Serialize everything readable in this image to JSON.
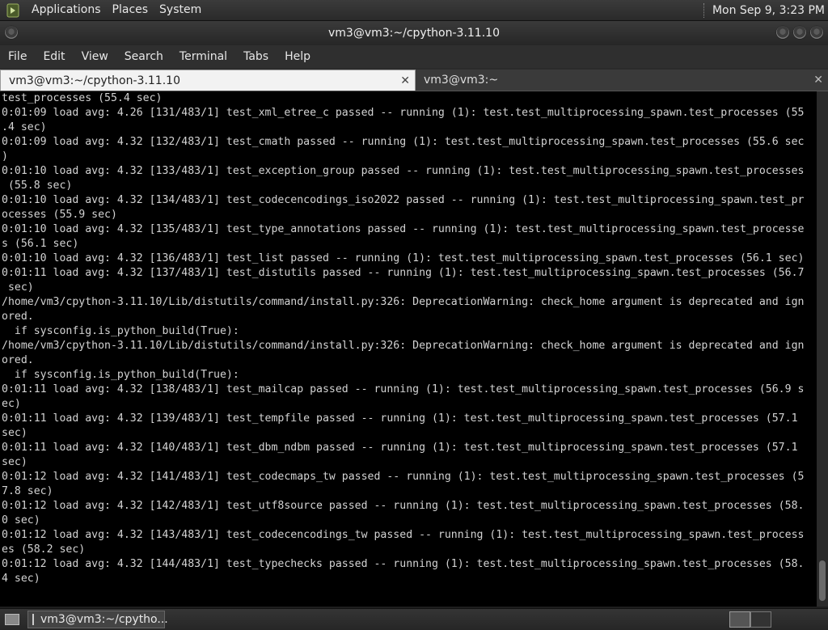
{
  "top_panel": {
    "menus": [
      "Applications",
      "Places",
      "System"
    ],
    "clock": "Mon Sep  9,  3:23 PM"
  },
  "window": {
    "title": "vm3@vm3:~/cpython-3.11.10"
  },
  "menubar": [
    "File",
    "Edit",
    "View",
    "Search",
    "Terminal",
    "Tabs",
    "Help"
  ],
  "tabs": [
    {
      "label": "vm3@vm3:~/cpython-3.11.10",
      "close": "✕"
    },
    {
      "label": "vm3@vm3:~",
      "close": "✕"
    }
  ],
  "terminal": {
    "lines": [
      "test_processes (55.4 sec)",
      "0:01:09 load avg: 4.26 [131/483/1] test_xml_etree_c passed -- running (1): test.test_multiprocessing_spawn.test_processes (55",
      ".4 sec)",
      "0:01:09 load avg: 4.32 [132/483/1] test_cmath passed -- running (1): test.test_multiprocessing_spawn.test_processes (55.6 sec",
      ")",
      "0:01:10 load avg: 4.32 [133/483/1] test_exception_group passed -- running (1): test.test_multiprocessing_spawn.test_processes",
      " (55.8 sec)",
      "0:01:10 load avg: 4.32 [134/483/1] test_codecencodings_iso2022 passed -- running (1): test.test_multiprocessing_spawn.test_pr",
      "ocesses (55.9 sec)",
      "0:01:10 load avg: 4.32 [135/483/1] test_type_annotations passed -- running (1): test.test_multiprocessing_spawn.test_processe",
      "s (56.1 sec)",
      "0:01:10 load avg: 4.32 [136/483/1] test_list passed -- running (1): test.test_multiprocessing_spawn.test_processes (56.1 sec)",
      "0:01:11 load avg: 4.32 [137/483/1] test_distutils passed -- running (1): test.test_multiprocessing_spawn.test_processes (56.7",
      " sec)",
      "/home/vm3/cpython-3.11.10/Lib/distutils/command/install.py:326: DeprecationWarning: check_home argument is deprecated and ign",
      "ored.",
      "  if sysconfig.is_python_build(True):",
      "/home/vm3/cpython-3.11.10/Lib/distutils/command/install.py:326: DeprecationWarning: check_home argument is deprecated and ign",
      "ored.",
      "  if sysconfig.is_python_build(True):",
      "0:01:11 load avg: 4.32 [138/483/1] test_mailcap passed -- running (1): test.test_multiprocessing_spawn.test_processes (56.9 s",
      "ec)",
      "0:01:11 load avg: 4.32 [139/483/1] test_tempfile passed -- running (1): test.test_multiprocessing_spawn.test_processes (57.1",
      "sec)",
      "0:01:11 load avg: 4.32 [140/483/1] test_dbm_ndbm passed -- running (1): test.test_multiprocessing_spawn.test_processes (57.1",
      "sec)",
      "0:01:12 load avg: 4.32 [141/483/1] test_codecmaps_tw passed -- running (1): test.test_multiprocessing_spawn.test_processes (5",
      "7.8 sec)",
      "0:01:12 load avg: 4.32 [142/483/1] test_utf8source passed -- running (1): test.test_multiprocessing_spawn.test_processes (58.",
      "0 sec)",
      "0:01:12 load avg: 4.32 [143/483/1] test_codecencodings_tw passed -- running (1): test.test_multiprocessing_spawn.test_process",
      "es (58.2 sec)",
      "0:01:12 load avg: 4.32 [144/483/1] test_typechecks passed -- running (1): test.test_multiprocessing_spawn.test_processes (58.",
      "4 sec)"
    ]
  },
  "taskbar": {
    "task_label": "vm3@vm3:~/cpytho..."
  }
}
